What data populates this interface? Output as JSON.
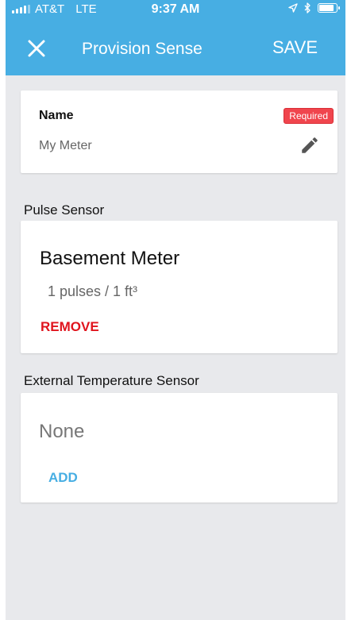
{
  "status_bar": {
    "carrier": "AT&T",
    "network": "LTE",
    "time": "9:37 AM"
  },
  "header": {
    "title": "Provision Sense",
    "save_label": "SAVE",
    "close_icon": "close-icon",
    "background_color": "#47aee3"
  },
  "name_card": {
    "label": "Name",
    "value": "My Meter",
    "required_badge": "Required",
    "edit_icon": "pencil-icon"
  },
  "pulse_section": {
    "heading": "Pulse Sensor",
    "sensor_name": "Basement Meter",
    "rate": "1 pulses / 1 ft³",
    "remove_label": "REMOVE",
    "remove_color": "#e0141d"
  },
  "temperature_section": {
    "heading": "External Temperature Sensor",
    "value": "None",
    "add_label": "ADD",
    "add_color": "#47aee3"
  }
}
